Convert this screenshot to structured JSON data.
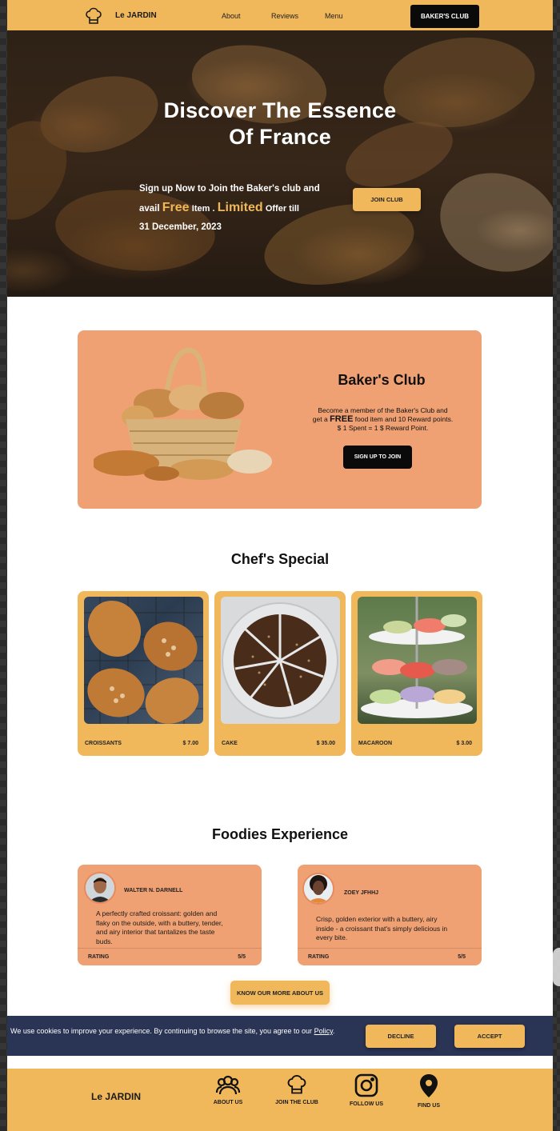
{
  "nav": {
    "brand": "Le JARDIN",
    "links": [
      "About",
      "Reviews",
      "Menu"
    ],
    "cta": "BAKER'S CLUB",
    "logo_icon": "chef-hat-icon"
  },
  "hero": {
    "title_line1": "Discover The Essence",
    "title_line2": "Of France",
    "promo_part1": "Sign up Now to Join the Baker's club and avail",
    "promo_free": "Free",
    "promo_part2": "Item .",
    "promo_limited": "Limited",
    "promo_part3": "Offer till",
    "promo_date": "31 December, 2023",
    "join_label": "JOIN CLUB"
  },
  "club": {
    "title": "Baker's Club",
    "desc_line1": "Become a member of the Baker's Club and",
    "desc_pre": "get a",
    "desc_free": "FREE",
    "desc_post": "food item and 10 Reward points.",
    "desc_line3": "$ 1 Spent = 1 $ Reward Point.",
    "signup_label": "SIGN UP TO JOIN"
  },
  "specials": {
    "title": "Chef's Special",
    "items": [
      {
        "name": "CROISSANTS",
        "price": "$ 7.00"
      },
      {
        "name": "CAKE",
        "price": "$ 35.00"
      },
      {
        "name": "MACAROON",
        "price": "$ 3.00"
      }
    ]
  },
  "foodies": {
    "title": "Foodies Experience",
    "reviews": [
      {
        "name": "WALTER N. DARNELL",
        "text": "A perfectly crafted croissant: golden and flaky on the outside, with a buttery, tender, and airy interior that tantalizes the taste buds.",
        "rating_label": "RATING",
        "rating": "5/5"
      },
      {
        "name": "ZOEY JFHHJ",
        "text": "Crisp, golden exterior with a buttery, airy inside - a croissant that's simply delicious in every bite.",
        "rating_label": "RATING",
        "rating": "5/5"
      }
    ],
    "more_label": "KNOW OUR MORE ABOUT US"
  },
  "cookie": {
    "text": "We use cookies to improve your experience. By continuing to browse the site, you agree to our",
    "policy": "Policy",
    "decline": "DECLINE",
    "accept": "ACCEPT"
  },
  "footer": {
    "brand": "Le JARDIN",
    "items": [
      {
        "label": "ABOUT US",
        "icon": "people-icon"
      },
      {
        "label": "JOIN THE CLUB",
        "icon": "chef-hat-icon"
      },
      {
        "label": "FOLLOW US",
        "icon": "instagram-icon"
      },
      {
        "label": "FIND US",
        "icon": "location-pin-icon"
      }
    ]
  },
  "colors": {
    "accent": "#f0b85a",
    "salmon": "#f0a173",
    "dark": "#0a0a0a",
    "cookie_bar": "#2a3455"
  }
}
